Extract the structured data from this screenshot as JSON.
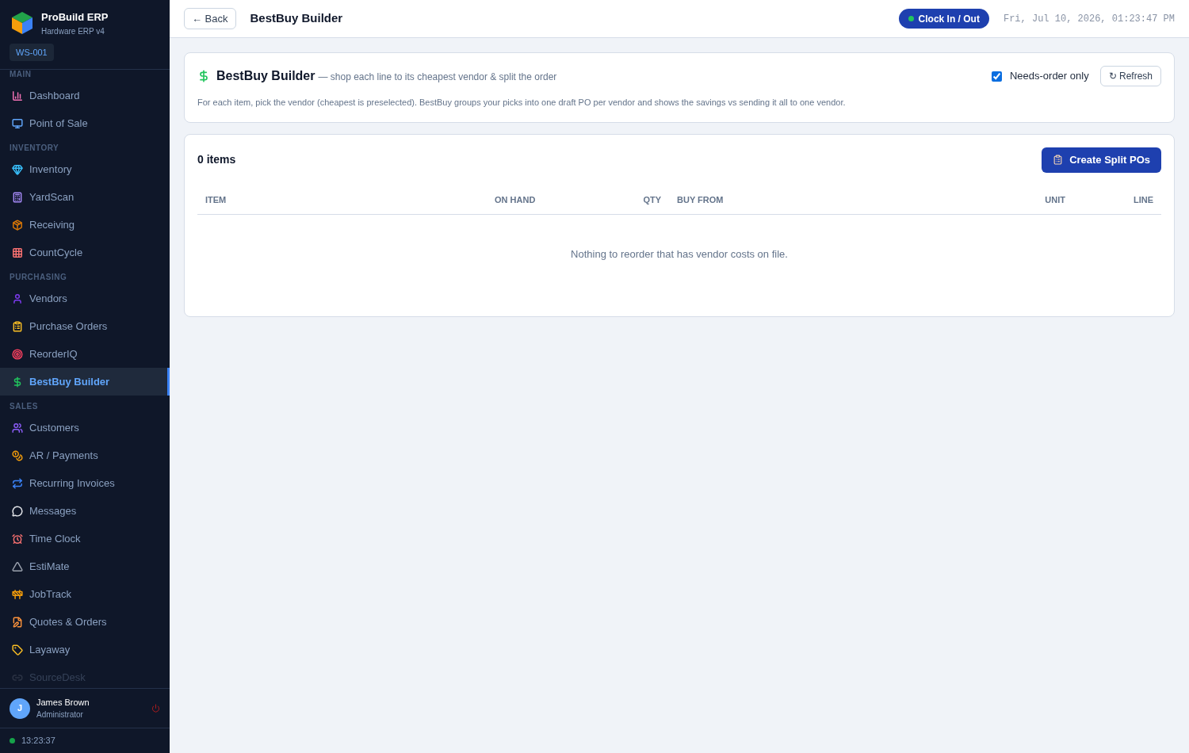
{
  "brand": {
    "name": "ProBuild ERP",
    "subtitle": "Hardware ERP v4",
    "workstation": "WS-001"
  },
  "sidebar": {
    "sections": [
      {
        "label": "MAIN",
        "items": [
          {
            "label": "Dashboard",
            "selected": false,
            "disabled": false
          },
          {
            "label": "Point of Sale",
            "selected": false,
            "disabled": false
          }
        ]
      },
      {
        "label": "INVENTORY",
        "items": [
          {
            "label": "Inventory",
            "selected": false,
            "disabled": false
          },
          {
            "label": "YardScan",
            "selected": false,
            "disabled": false
          },
          {
            "label": "Receiving",
            "selected": false,
            "disabled": false
          },
          {
            "label": "CountCycle",
            "selected": false,
            "disabled": false
          }
        ]
      },
      {
        "label": "PURCHASING",
        "items": [
          {
            "label": "Vendors",
            "selected": false,
            "disabled": false
          },
          {
            "label": "Purchase Orders",
            "selected": false,
            "disabled": false
          },
          {
            "label": "ReorderIQ",
            "selected": false,
            "disabled": false
          },
          {
            "label": "BestBuy Builder",
            "selected": true,
            "disabled": false
          }
        ]
      },
      {
        "label": "SALES",
        "items": [
          {
            "label": "Customers",
            "selected": false,
            "disabled": false
          },
          {
            "label": "AR / Payments",
            "selected": false,
            "disabled": false
          },
          {
            "label": "Recurring Invoices",
            "selected": false,
            "disabled": false
          },
          {
            "label": "Messages",
            "selected": false,
            "disabled": false
          },
          {
            "label": "Time Clock",
            "selected": false,
            "disabled": false
          },
          {
            "label": "EstiMate",
            "selected": false,
            "disabled": false
          },
          {
            "label": "JobTrack",
            "selected": false,
            "disabled": false
          },
          {
            "label": "Quotes & Orders",
            "selected": false,
            "disabled": false
          },
          {
            "label": "Layaway",
            "selected": false,
            "disabled": false
          },
          {
            "label": "SourceDesk",
            "selected": false,
            "disabled": true
          }
        ]
      }
    ]
  },
  "user": {
    "initial": "J",
    "name": "James Brown",
    "role": "Administrator",
    "clock": "13:23:37"
  },
  "header": {
    "back": "← Back",
    "title": "BestBuy Builder",
    "clock_button": "Clock In / Out",
    "datetime": "Fri, Jul 10, 2026, 01:23:47 PM"
  },
  "intro": {
    "title": "BestBuy Builder",
    "tagline": "— shop each line to its cheapest vendor & split the order",
    "filter": {
      "label": "Needs-order only",
      "checked": true
    },
    "refresh": "↻ Refresh",
    "description": "For each item, pick the vendor (cheapest is preselected). BestBuy groups your picks into one draft PO per vendor and shows the savings vs sending it all to one vendor."
  },
  "table": {
    "count": "0 items",
    "action": "Create Split POs",
    "columns": [
      "ITEM",
      "ON HAND",
      "QTY",
      "BUY FROM",
      "UNIT",
      "LINE"
    ],
    "empty": "Nothing to reorder that has vendor costs on file."
  }
}
